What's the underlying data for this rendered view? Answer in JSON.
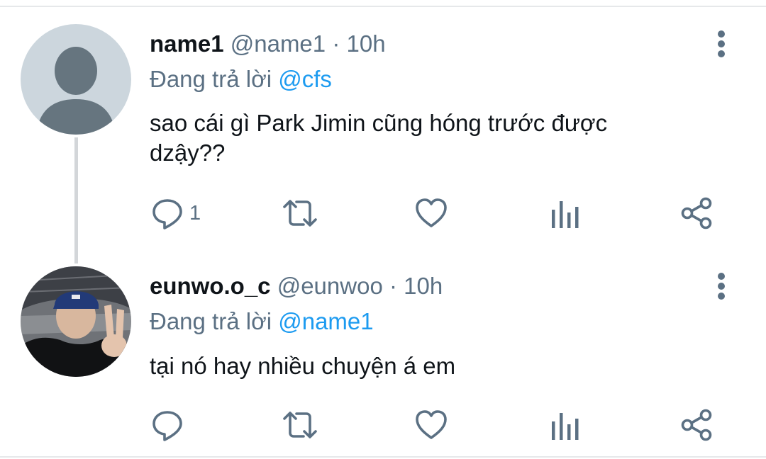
{
  "tweets": [
    {
      "display_name": "name1",
      "handle": "@name1",
      "separator": "·",
      "time": "10h",
      "reply_prefix": "Đang trả lời",
      "reply_to": "@cfs",
      "text": "sao cái gì Park Jimin cũng hóng trước được dzậy??",
      "reply_count": "1"
    },
    {
      "display_name": "eunwo.o_c",
      "handle": "@eunwoo",
      "separator": "·",
      "time": "10h",
      "reply_prefix": "Đang trả lời",
      "reply_to": "@name1",
      "text": "tại nó hay nhiều chuyện á em",
      "reply_count": ""
    }
  ],
  "icons": {
    "reply": "comment-icon",
    "retweet": "retweet-icon",
    "like": "heart-icon",
    "analytics": "bar-chart-icon",
    "share": "share-icon",
    "more": "more-vertical-icon"
  },
  "colors": {
    "text": "#0f1419",
    "muted": "#5b7083",
    "link": "#1d9bf0",
    "thread_line": "#d3d6d9",
    "default_avatar_bg": "#ccd6dd",
    "default_avatar_fg": "#66757f"
  }
}
